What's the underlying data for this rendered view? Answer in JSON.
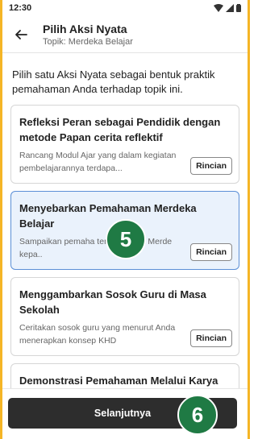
{
  "status_bar": {
    "time": "12:30",
    "icons": [
      "wifi-icon",
      "signal-icon",
      "battery-icon"
    ]
  },
  "app_bar": {
    "back_icon": "arrow-left-icon",
    "title": "Pilih Aksi Nyata",
    "subtitle": "Topik: Merdeka Belajar"
  },
  "intro": "Pilih satu Aksi Nyata sebagai bentuk praktik pemahaman Anda terhadap topik ini.",
  "cards": [
    {
      "title": "Refleksi Peran sebagai Pendidik dengan metode Papan cerita reflektif",
      "description": "Rancang Modul Ajar yang dalam kegiatan pembelajarannya terdapa...",
      "button": "Rincian",
      "selected": false
    },
    {
      "title": "Menyebarkan Pemahaman Merdeka Belajar",
      "description": "Sampaikan pemaha tentang topik Merde kepa..",
      "button": "Rincian",
      "selected": true
    },
    {
      "title": "Menggambarkan Sosok Guru di Masa Sekolah",
      "description": "Ceritakan sosok guru yang menurut Anda menerapkan konsep KHD",
      "button": "Rincian",
      "selected": false
    },
    {
      "title": "Demonstrasi Pemahaman Melalui Karya",
      "description": "",
      "button": "",
      "selected": false
    }
  ],
  "primary_button": "Selanjutnya",
  "step_markers": [
    "5",
    "6"
  ],
  "colors": {
    "frame": "#f5b526",
    "selected_border": "#5b8fd6",
    "selected_bg": "#eaf2fc",
    "primary_button": "#2d2d2d",
    "step_marker": "#1f7a44"
  }
}
